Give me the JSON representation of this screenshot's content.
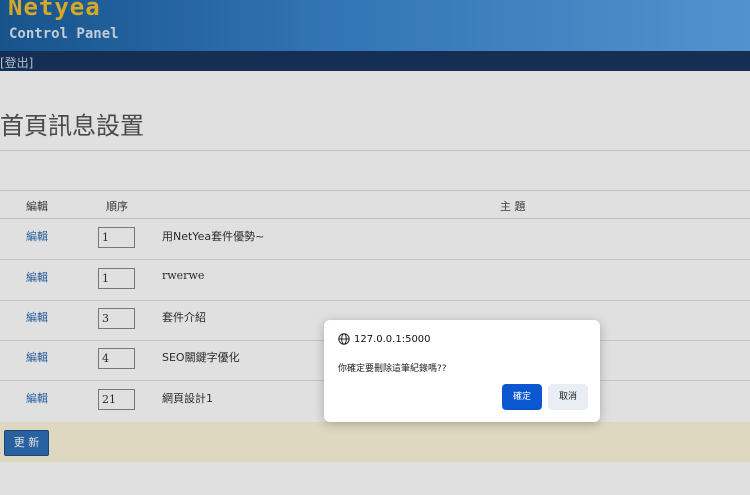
{
  "header": {
    "logo_title": "Netyea",
    "logo_subtitle": "Control Panel"
  },
  "userbar": {
    "logout": "[登出]"
  },
  "page": {
    "title": "首頁訊息設置"
  },
  "table": {
    "columns": {
      "edit": "編輯",
      "order": "順序",
      "subject": "主 題"
    },
    "rows": [
      {
        "edit": "編輯",
        "order": "1",
        "subject": "用NetYea套件優勢~"
      },
      {
        "edit": "編輯",
        "order": "1",
        "subject": "rwerwe"
      },
      {
        "edit": "編輯",
        "order": "3",
        "subject": "套件介紹"
      },
      {
        "edit": "編輯",
        "order": "4",
        "subject": "SEO關鍵字優化"
      },
      {
        "edit": "編輯",
        "order": "21",
        "subject": "網頁設計1"
      }
    ]
  },
  "actions": {
    "update": "更 新"
  },
  "dialog": {
    "origin": "127.0.0.1:5000",
    "message": "你確定要刪除這筆紀錄嗎??",
    "ok": "確定",
    "cancel": "取消",
    "icon": "globe-icon"
  },
  "colors": {
    "banner": "#2e78c2",
    "userbar": "#17365f",
    "link": "#2f6db4",
    "ok_button": "#0b57d0",
    "update_bar": "#fdf6dc"
  }
}
